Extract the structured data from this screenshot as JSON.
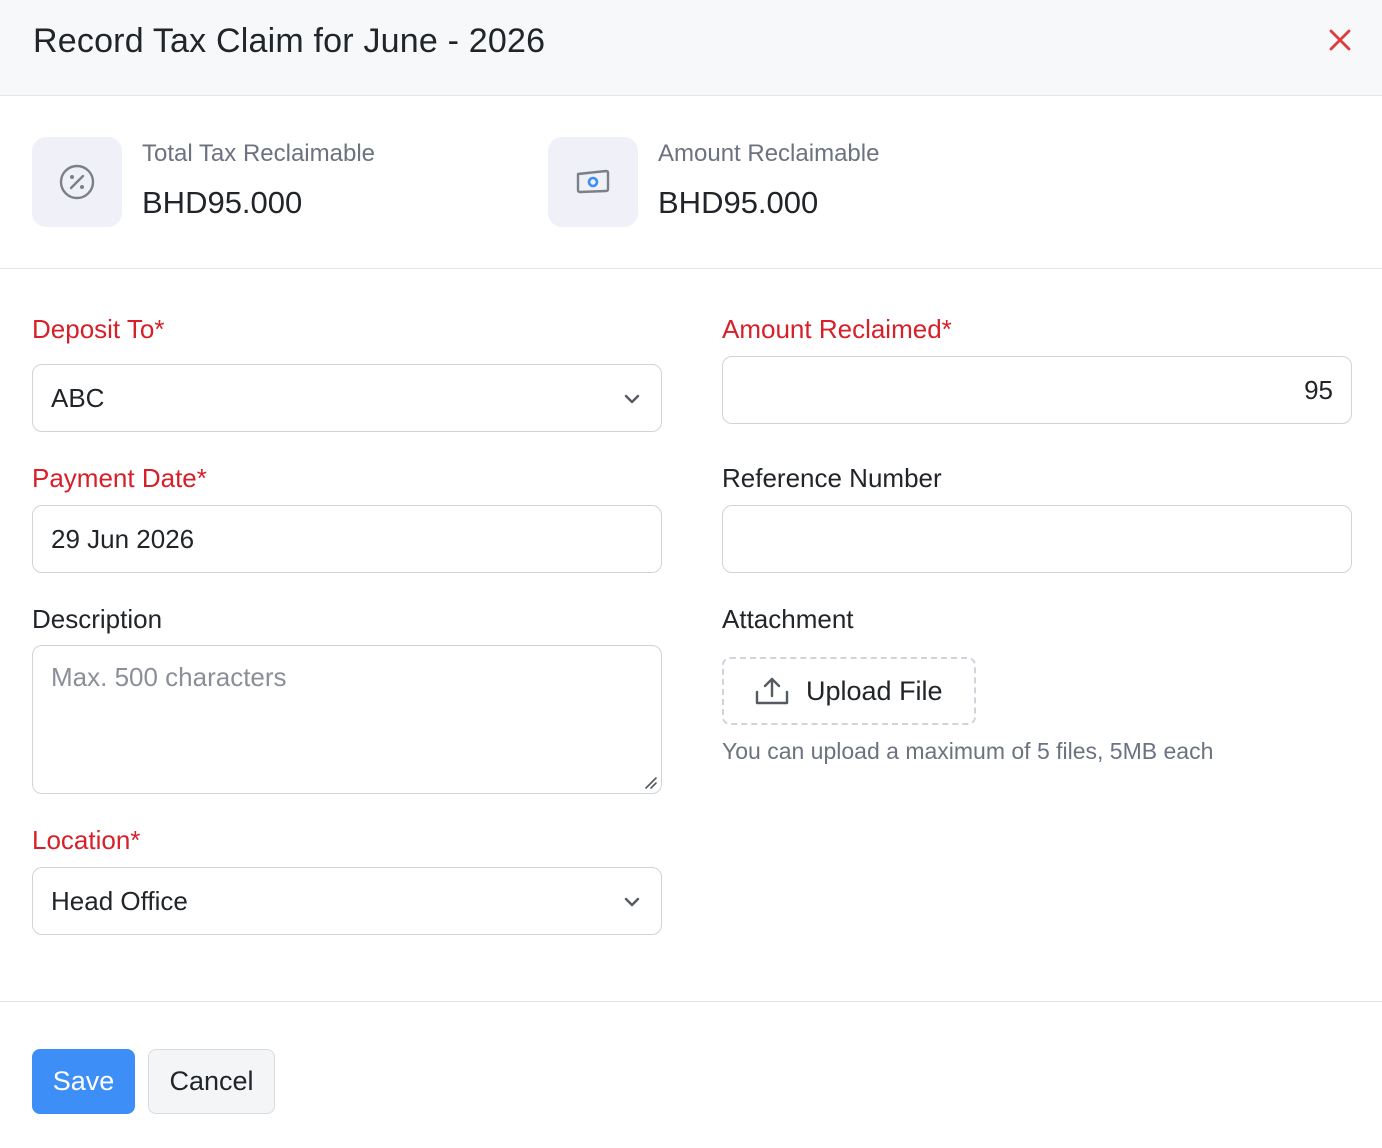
{
  "header": {
    "title": "Record Tax Claim for June - 2026",
    "close_icon": "close-icon",
    "close_color": "#e03b3b"
  },
  "summary": {
    "total_tax": {
      "icon": "percent-icon",
      "label": "Total Tax Reclaimable",
      "value": "BHD95.000"
    },
    "amount": {
      "icon": "cash-icon",
      "label": "Amount Reclaimable",
      "value": "BHD95.000"
    }
  },
  "form": {
    "deposit_to": {
      "label": "Deposit To*",
      "value": "ABC"
    },
    "amount_reclaimed": {
      "label": "Amount Reclaimed*",
      "value": "95"
    },
    "payment_date": {
      "label": "Payment Date*",
      "value": "29 Jun 2026"
    },
    "reference_number": {
      "label": "Reference Number",
      "value": ""
    },
    "description": {
      "label": "Description",
      "placeholder": "Max. 500 characters"
    },
    "attachment": {
      "label": "Attachment",
      "button": "Upload File",
      "hint": "You can upload a maximum of 5 files, 5MB each"
    },
    "location": {
      "label": "Location*",
      "value": "Head Office"
    }
  },
  "footer": {
    "save": "Save",
    "cancel": "Cancel"
  },
  "colors": {
    "required": "#d6202a",
    "primary": "#3e8ef7",
    "muted": "#6c7280"
  }
}
